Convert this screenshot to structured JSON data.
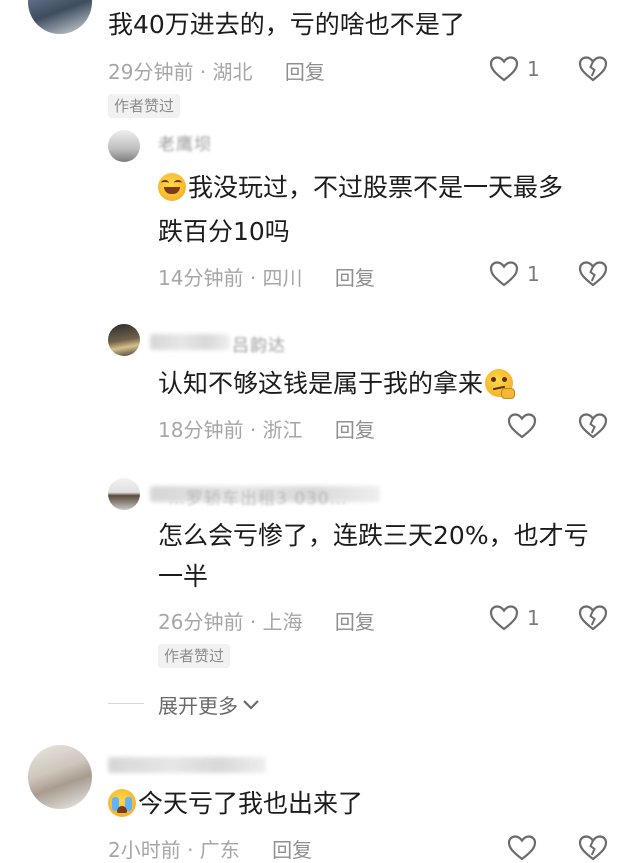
{
  "comments": [
    {
      "text": "我40万进去的，亏的啥也不是了",
      "time": "29分钟前",
      "region": "· 湖北",
      "reply_label": "回复",
      "like_count": "1",
      "badge": "作者赞过"
    },
    {
      "author": "老鹰坝",
      "text": "我没玩过，不过股票不是一天最多",
      "text_line2": "跌百分10吗",
      "emoji": "rofl-emoji",
      "time": "14分钟前",
      "region": "· 四川",
      "reply_label": "回复",
      "like_count": "1"
    },
    {
      "author": "吕韵达",
      "text": "认知不够这钱是属于我的拿来",
      "emoji": "thinking-emoji",
      "time": "18分钟前",
      "region": "· 浙江",
      "reply_label": "回复",
      "like_count": ""
    },
    {
      "author": "…罗轿车出租3 030…",
      "text": "怎么会亏惨了，连跌三天20%，也才亏",
      "text_line2": "一半",
      "time": "26分钟前",
      "region": "· 上海",
      "reply_label": "回复",
      "like_count": "1",
      "badge": "作者赞过"
    },
    {
      "text": "今天亏了我也出来了",
      "emoji": "crying-emoji",
      "time": "2小时前",
      "region": "· 广东",
      "reply_label": "回复",
      "like_count": ""
    }
  ],
  "expand_more": "展开更多",
  "colors": {
    "heart": "#6b6b6b",
    "meta": "#a6a6a6",
    "badge_bg": "#f1f1f1"
  }
}
